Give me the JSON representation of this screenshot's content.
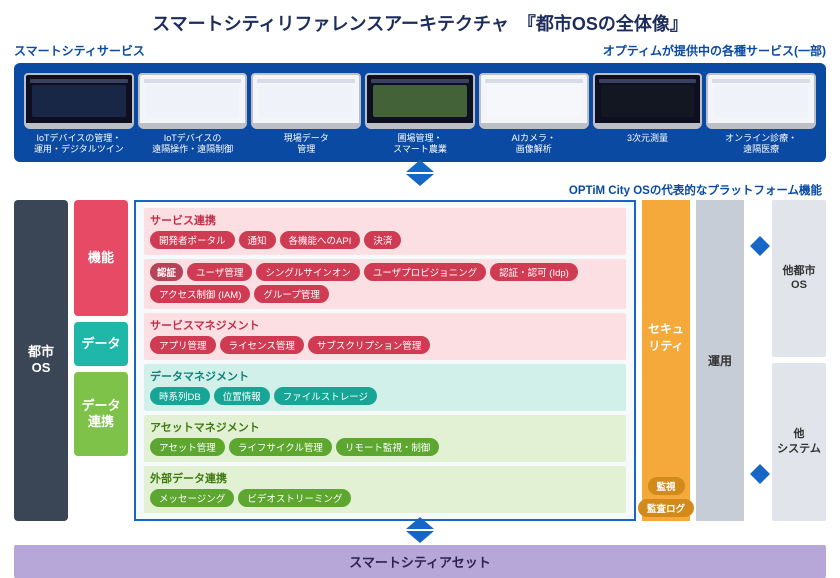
{
  "title_prefix": "スマートシティリファレンスアーキテクチャ",
  "title_quoted": "『都市OSの全体像』",
  "top_left_label": "スマートシティサービス",
  "top_right_label": "オプティムが提供中の各種サービス(一部)",
  "services": [
    {
      "label": "IoTデバイスの管理・\n運用・デジタルツイン"
    },
    {
      "label": "IoTデバイスの\n遠隔操作・遠隔制御"
    },
    {
      "label": "現場データ\n管理"
    },
    {
      "label": "圃場管理・\nスマート農業"
    },
    {
      "label": "AIカメラ・\n画像解析"
    },
    {
      "label": "3次元測量"
    },
    {
      "label": "オンライン診療・\n遠隔医療"
    }
  ],
  "platform_label": "OPTiM City OSの代表的なプラットフォーム機能",
  "left": {
    "os": "都市\nOS",
    "func": "機能",
    "data": "データ",
    "datalink": "データ\n連携"
  },
  "sections": [
    {
      "cls": "pink",
      "hdr": "サービス連携",
      "chipCls": "red",
      "chips": [
        "開発者ポータル",
        "通知",
        "各機能へのAPI",
        "決済"
      ]
    },
    {
      "cls": "pink",
      "hdr": "",
      "tag": "認証",
      "chipCls": "red",
      "chips": [
        "ユーザ管理",
        "シングルサインオン",
        "ユーザプロビジョニング",
        "認証・認可 (Idp)",
        "アクセス制御 (IAM)",
        "グループ管理"
      ]
    },
    {
      "cls": "pink",
      "hdr": "サービスマネジメント",
      "chipCls": "red",
      "chips": [
        "アプリ管理",
        "ライセンス管理",
        "サブスクリプション管理"
      ]
    },
    {
      "cls": "teal",
      "hdr": "データマネジメント",
      "chipCls": "tl",
      "chips": [
        "時系列DB",
        "位置情報",
        "ファイルストレージ"
      ]
    },
    {
      "cls": "green",
      "hdr": "アセットマネジメント",
      "chipCls": "gn",
      "chips": [
        "アセット管理",
        "ライフサイクル管理",
        "リモート監視・制御"
      ]
    },
    {
      "cls": "green",
      "hdr": "外部データ連携",
      "chipCls": "gn",
      "chips": [
        "メッセージング",
        "ビデオストリーミング"
      ]
    }
  ],
  "right": {
    "security": "セキュ\nリティ",
    "security_chips": [
      "監視",
      "監査ログ"
    ],
    "ops": "運用"
  },
  "ext": {
    "other_city": "他都市\nOS",
    "other_sys": "他\nシステム"
  },
  "asset_bar": "スマートシティアセット"
}
